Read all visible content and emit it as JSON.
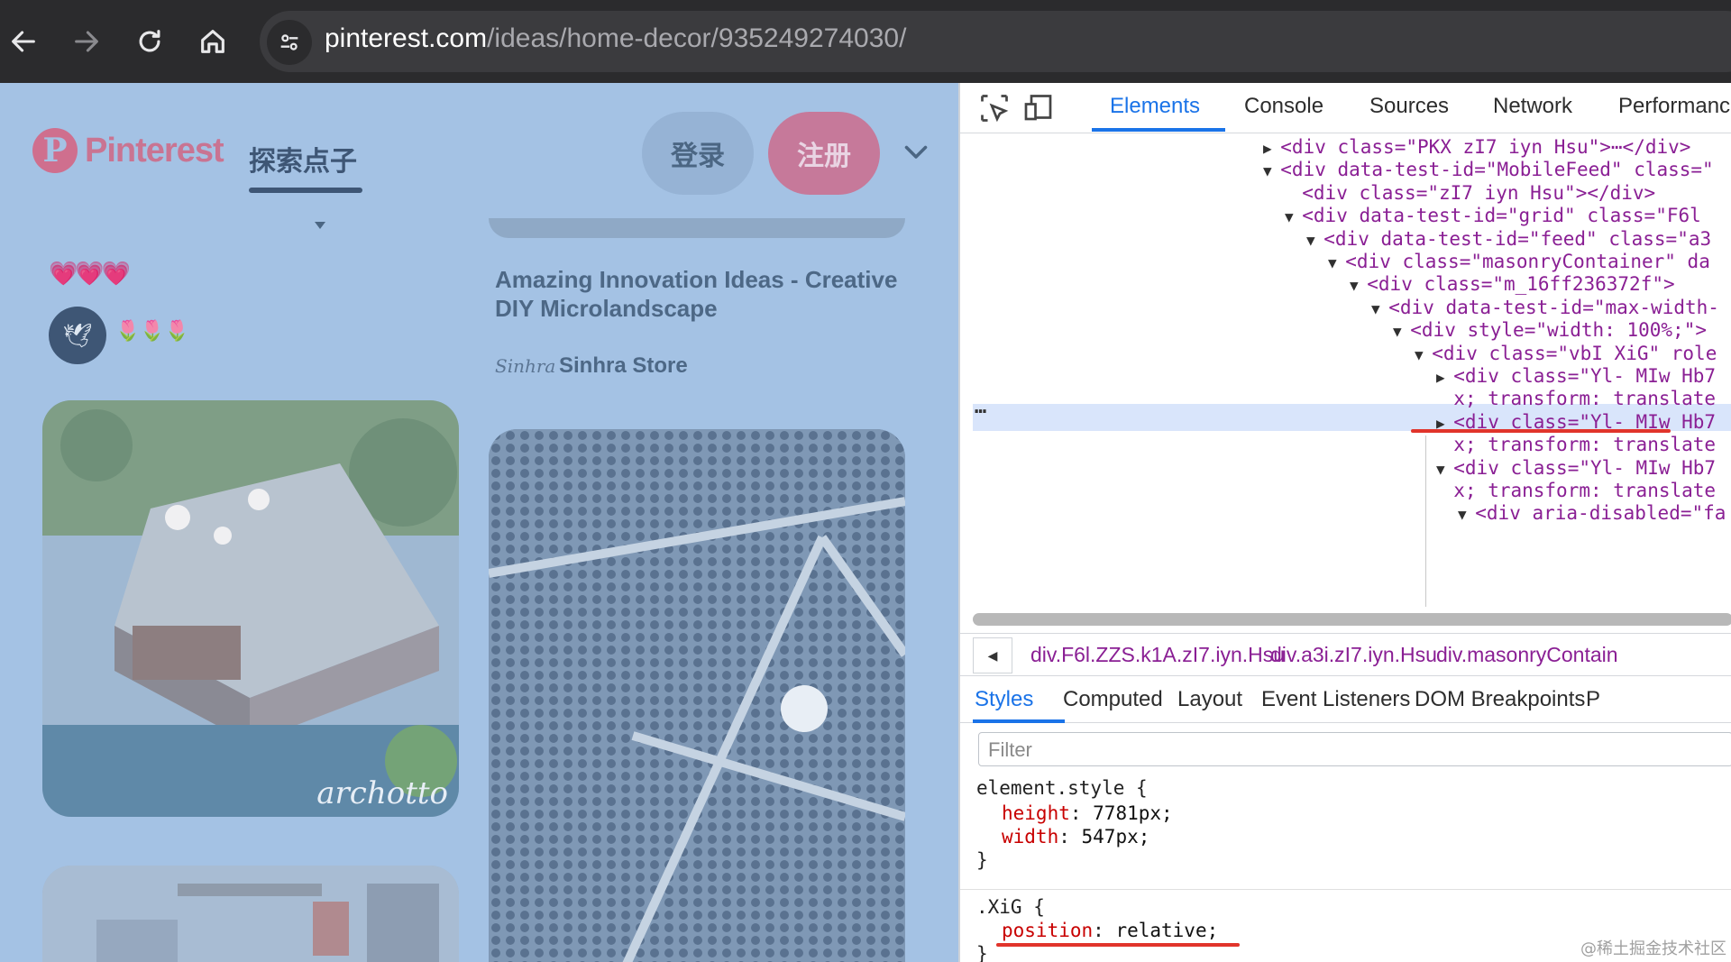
{
  "browser": {
    "url_host": "pinterest.com",
    "url_path": "/ideas/home-decor/935249274030/",
    "back_icon": "arrow-left-icon",
    "forward_icon": "arrow-right-icon",
    "reload_icon": "reload-icon",
    "home_icon": "home-icon",
    "site_settings_icon": "tune-icon"
  },
  "page": {
    "logo_text": "Pinterest",
    "explore_tab": "探索点子",
    "login_label": "登录",
    "signup_label": "注册",
    "hearts": "💗💗💗",
    "pin_user_name": "🌷🌷🌷",
    "pin_title": "Amazing Innovation Ideas - Creative DIY Microlandscape",
    "store_logo_text": "Sinhra",
    "store_name": "Sinhra Store",
    "bridge_watermark": "archotto",
    "colors": {
      "overlay": "#a4c2e4",
      "brand": "#c6799a"
    }
  },
  "devtools": {
    "tabs": [
      "Elements",
      "Console",
      "Sources",
      "Network",
      "Performanc"
    ],
    "dom_lines": [
      {
        "tri": "▶",
        "indent": 0,
        "html": "<div class=\"PKX zI7 iyn Hsu\">⋯</div>"
      },
      {
        "tri": "▼",
        "indent": 0,
        "html": "<div data-test-id=\"MobileFeed\" class=\""
      },
      {
        "tri": "",
        "indent": 1,
        "html": "<div class=\"zI7 iyn Hsu\"></div>"
      },
      {
        "tri": "▼",
        "indent": 1,
        "html": "<div data-test-id=\"grid\" class=\"F6l"
      },
      {
        "tri": "▼",
        "indent": 2,
        "html": "<div data-test-id=\"feed\" class=\"a3"
      },
      {
        "tri": "▼",
        "indent": 3,
        "html": "<div class=\"masonryContainer\" da"
      },
      {
        "tri": "▼",
        "indent": 4,
        "html": "<div class=\"m_16ff236372f\">"
      },
      {
        "tri": "▼",
        "indent": 5,
        "html": "<div data-test-id=\"max-width-"
      },
      {
        "tri": "▼",
        "indent": 6,
        "html": "<div style=\"width: 100%;\">"
      },
      {
        "tri": "▼",
        "indent": 7,
        "html": "<div class=\"vbI XiG\" role"
      },
      {
        "tri": "▶",
        "indent": 8,
        "html": "<div class=\"Yl- MIw Hb7"
      },
      {
        "tri": "",
        "indent": 8,
        "html": "x; transform: translate"
      },
      {
        "tri": "▶",
        "indent": 8,
        "html": "<div class=\"Yl- MIw Hb7"
      },
      {
        "tri": "",
        "indent": 8,
        "html": "x; transform: translate"
      },
      {
        "tri": "▼",
        "indent": 8,
        "html": "<div class=\"Yl- MIw Hb7"
      },
      {
        "tri": "",
        "indent": 8,
        "html": "x; transform: translate"
      },
      {
        "tri": "▼",
        "indent": 9,
        "html": "<div aria-disabled=\"fa"
      }
    ],
    "selected_ellipsis": "⋯",
    "breadcrumbs": [
      "div.F6l.ZZS.k1A.zI7.iyn.Hsu",
      "div.a3i.zI7.iyn.Hsu",
      "div.masonryContain"
    ],
    "style_tabs": [
      "Styles",
      "Computed",
      "Layout",
      "Event Listeners",
      "DOM Breakpoints",
      "P"
    ],
    "filter_placeholder": "Filter",
    "css": {
      "rule1_selector": "element.style {",
      "rule1_prop1": "height",
      "rule1_val1": "7781px;",
      "rule1_prop2": "width",
      "rule1_val2": "547px;",
      "close": "}",
      "rule2_selector": ".XiG {",
      "rule2_prop1": "position",
      "rule2_val1": "relative;"
    },
    "corner_watermark": "@稀土掘金技术社区",
    "colors": {
      "accent": "#1a73e8",
      "highlight": "#e1342b"
    }
  }
}
